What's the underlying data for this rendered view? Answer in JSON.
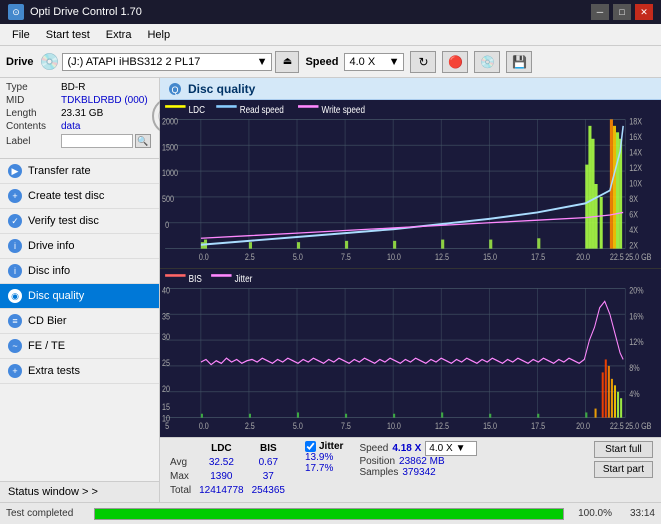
{
  "titleBar": {
    "title": "Opti Drive Control 1.70",
    "minBtn": "─",
    "maxBtn": "□",
    "closeBtn": "✕"
  },
  "menuBar": {
    "items": [
      "File",
      "Start test",
      "Extra",
      "Help"
    ]
  },
  "driveBar": {
    "label": "Drive",
    "driveValue": "(J:)  ATAPI iHBS312  2 PL17",
    "speedLabel": "Speed",
    "speedValue": "4.0 X",
    "ejectSymbol": "⏏"
  },
  "disc": {
    "typeLabel": "Type",
    "typeValue": "BD-R",
    "midLabel": "MID",
    "midValue": "TDKBLDRBD (000)",
    "lengthLabel": "Length",
    "lengthValue": "23.31 GB",
    "contentsLabel": "Contents",
    "contentsValue": "data",
    "labelLabel": "Label"
  },
  "navItems": [
    {
      "id": "transfer-rate",
      "label": "Transfer rate",
      "iconType": "blue"
    },
    {
      "id": "create-test-disc",
      "label": "Create test disc",
      "iconType": "blue"
    },
    {
      "id": "verify-test-disc",
      "label": "Verify test disc",
      "iconType": "blue"
    },
    {
      "id": "drive-info",
      "label": "Drive info",
      "iconType": "blue"
    },
    {
      "id": "disc-info",
      "label": "Disc info",
      "iconType": "blue"
    },
    {
      "id": "disc-quality",
      "label": "Disc quality",
      "iconType": "blue",
      "active": true
    },
    {
      "id": "cd-bier",
      "label": "CD Bier",
      "iconType": "blue"
    },
    {
      "id": "fe-te",
      "label": "FE / TE",
      "iconType": "blue"
    },
    {
      "id": "extra-tests",
      "label": "Extra tests",
      "iconType": "blue"
    }
  ],
  "statusWindow": {
    "label": "Status window > >"
  },
  "discQuality": {
    "title": "Disc quality"
  },
  "chart1": {
    "legend": [
      {
        "label": "LDC",
        "color": "#ffff00"
      },
      {
        "label": "Read speed",
        "color": "#aaddff"
      },
      {
        "label": "Write speed",
        "color": "#ff88ff"
      }
    ],
    "yLeftMax": 2000,
    "yRightLabels": [
      "18X",
      "16X",
      "14X",
      "12X",
      "10X",
      "8X",
      "6X",
      "4X",
      "2X"
    ],
    "xMax": 25
  },
  "chart2": {
    "legend": [
      {
        "label": "BIS",
        "color": "#ff6666"
      },
      {
        "label": "Jitter",
        "color": "#ff88ff"
      }
    ],
    "yLeftMax": 40,
    "yRightLabels": [
      "20%",
      "16%",
      "12%",
      "8%",
      "4%"
    ],
    "xMax": 25
  },
  "stats": {
    "ldcLabel": "LDC",
    "bisLabel": "BIS",
    "jitterLabel": "Jitter",
    "speedLabel": "Speed",
    "speedValue": "4.18 X",
    "speedDropdown": "4.0 X",
    "rows": [
      {
        "label": "Avg",
        "ldc": "32.52",
        "bis": "0.67",
        "jitter": "13.9%"
      },
      {
        "label": "Max",
        "ldc": "1390",
        "bis": "37",
        "jitter": "17.7%"
      },
      {
        "label": "Total",
        "ldc": "12414778",
        "bis": "254365",
        "jitter": ""
      }
    ],
    "positionLabel": "Position",
    "positionValue": "23862 MB",
    "samplesLabel": "Samples",
    "samplesValue": "379342",
    "startFullBtn": "Start full",
    "startPartBtn": "Start part"
  },
  "statusBar": {
    "text": "Test completed",
    "progress": 100,
    "percent": "100.0%",
    "time": "33:14"
  }
}
